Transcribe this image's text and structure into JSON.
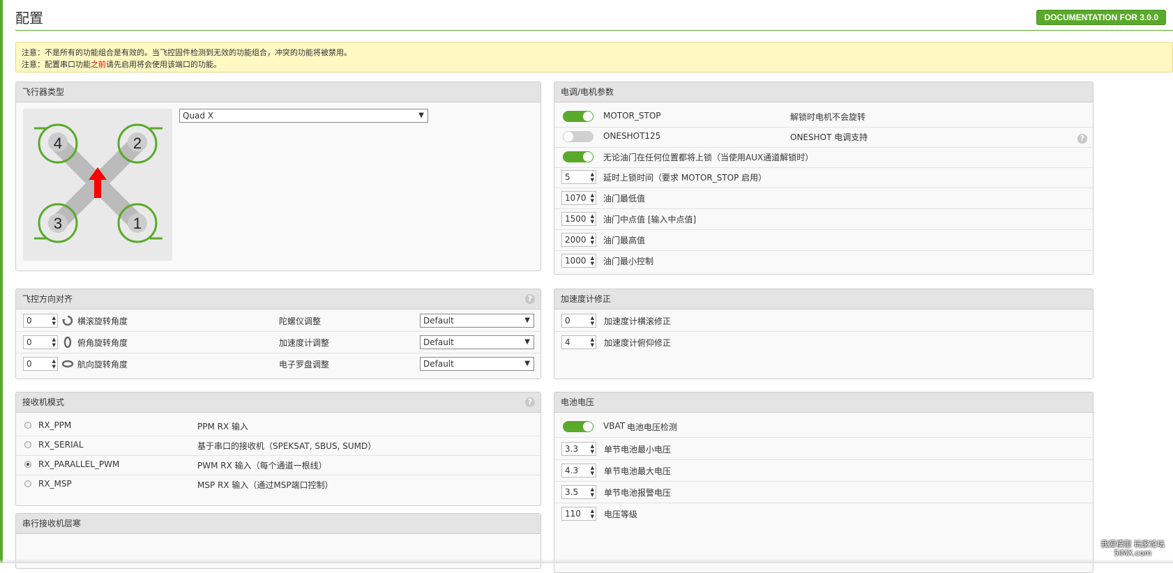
{
  "page": {
    "title": "配置",
    "doc_button": "DOCUMENTATION FOR 3.0.0"
  },
  "note": {
    "line1": "注意：不是所有的功能组合是有效的。当飞控固件检测到无效的功能组合，冲突的功能将被禁用。",
    "line2_a": "注意：配置串口功能",
    "line2_highlight": "之前",
    "line2_b": "请先启用将会使用该端口的功能。"
  },
  "aircraft": {
    "header": "飞行器类型",
    "selected": "Quad X",
    "motors": [
      "4",
      "2",
      "3",
      "1"
    ]
  },
  "esc": {
    "header": "电调/电机参数",
    "motor_stop": {
      "label": "MOTOR_STOP",
      "desc": "解锁时电机不会旋转",
      "on": true
    },
    "oneshot": {
      "label": "ONESHOT125",
      "desc": "ONESHOT 电调支持",
      "on": false
    },
    "arm_any": {
      "label": "无论油门在任何位置都将上锁（当使用AUX通道解锁时）",
      "on": true
    },
    "delay": {
      "value": "5",
      "label": "延时上锁时间（要求 MOTOR_STOP 启用）"
    },
    "min_throttle": {
      "value": "1070",
      "label": "油门最低值"
    },
    "mid_throttle": {
      "value": "1500",
      "label": "油门中点值 [输入中点值]"
    },
    "max_throttle": {
      "value": "2000",
      "label": "油门最高值"
    },
    "min_command": {
      "value": "1000",
      "label": "油门最小控制"
    }
  },
  "board": {
    "header": "飞控方向对齐",
    "roll": {
      "value": "0",
      "label": "横滚旋转角度"
    },
    "pitch": {
      "value": "0",
      "label": "俯角旋转角度"
    },
    "yaw": {
      "value": "0",
      "label": "航向旋转角度"
    },
    "gyro": {
      "label": "陀螺仪调整",
      "value": "Default"
    },
    "acc": {
      "label": "加速度计调整",
      "value": "Default"
    },
    "mag": {
      "label": "电子罗盘调整",
      "value": "Default"
    }
  },
  "acc_trim": {
    "header": "加速度计修正",
    "roll": {
      "value": "0",
      "label": "加速度计横滚修正"
    },
    "pitch": {
      "value": "4",
      "label": "加速度计俯仰修正"
    }
  },
  "receiver": {
    "header": "接收机模式",
    "options": [
      {
        "name": "RX_PPM",
        "desc": "PPM RX 输入",
        "selected": false
      },
      {
        "name": "RX_SERIAL",
        "desc": "基于串口的接收机（SPEKSAT, SBUS, SUMD）",
        "selected": false
      },
      {
        "name": "RX_PARALLEL_PWM",
        "desc": "PWM RX 输入（每个通道一根线）",
        "selected": true
      },
      {
        "name": "RX_MSP",
        "desc": "MSP RX 输入（通过MSP端口控制）",
        "selected": false
      }
    ]
  },
  "serial_rx": {
    "header": "串行接收机层寒"
  },
  "battery": {
    "header": "电池电压",
    "vbat": {
      "label": "VBAT",
      "desc": "电池电压检测",
      "on": true
    },
    "min_cell": {
      "value": "3.3",
      "label": "单节电池最小电压"
    },
    "max_cell": {
      "value": "4.3",
      "label": "单节电池最大电压"
    },
    "warn_cell": {
      "value": "3.5",
      "label": "单节电池报警电压"
    },
    "scale": {
      "value": "110",
      "label": "电压等级"
    }
  },
  "watermark": {
    "line1": "我爱模型 玩家论坛",
    "line2": "5iMX.com"
  },
  "colors": {
    "accent": "#59aa29",
    "note_bg": "#fef8c3",
    "arrow": "#ff0000"
  }
}
